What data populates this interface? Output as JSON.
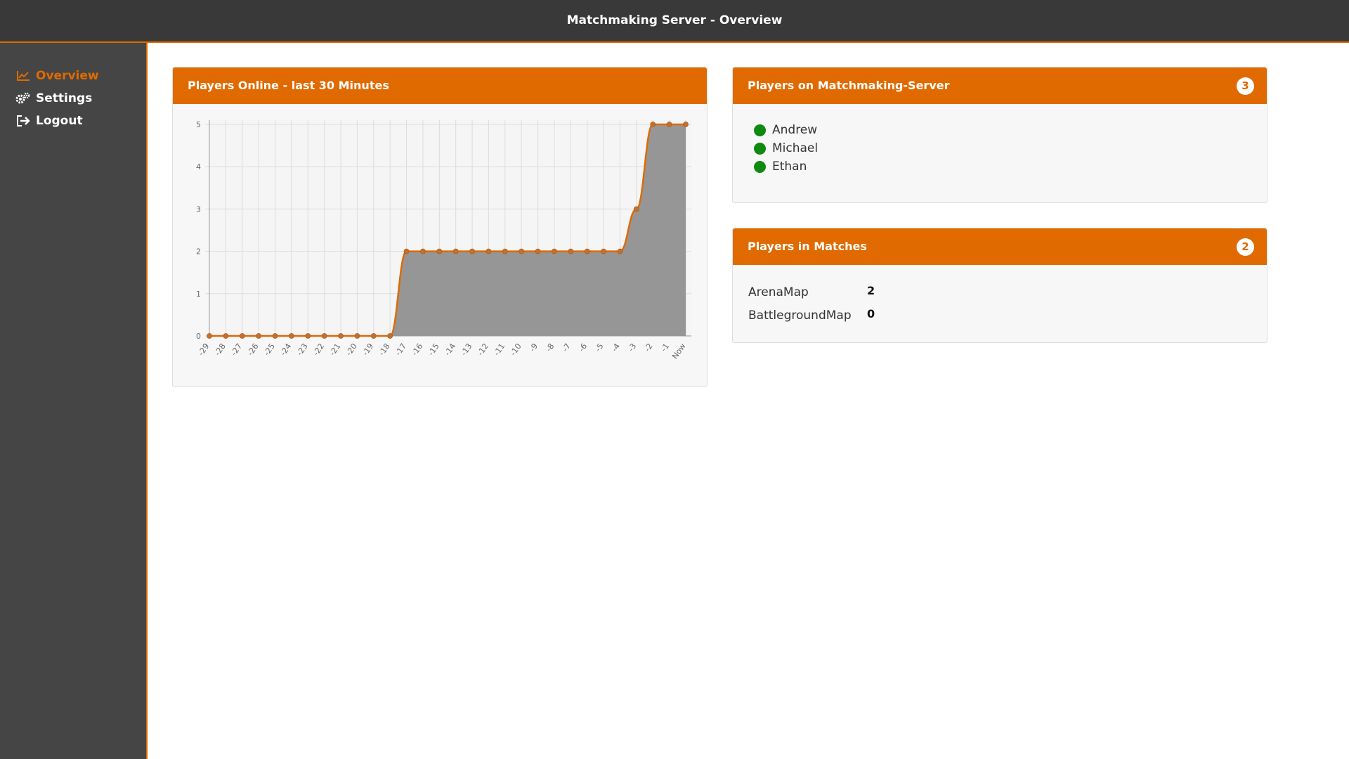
{
  "header": {
    "title": "Matchmaking Server - Overview"
  },
  "sidebar": {
    "items": [
      {
        "label": "Overview",
        "icon": "line-chart-icon",
        "active": true
      },
      {
        "label": "Settings",
        "icon": "gears-icon",
        "active": false
      },
      {
        "label": "Logout",
        "icon": "sign-out-icon",
        "active": false
      }
    ]
  },
  "colors": {
    "accent": "#e06a00",
    "online": "#0e8a0e",
    "area": "#969696"
  },
  "players_online_panel": {
    "title": "Players Online - last 30 Minutes"
  },
  "server_panel": {
    "title": "Players on Matchmaking-Server",
    "count": "3",
    "players": [
      "Andrew",
      "Michael",
      "Ethan"
    ]
  },
  "matches_panel": {
    "title": "Players in Matches",
    "count": "2",
    "maps": [
      {
        "name": "ArenaMap",
        "value": "2"
      },
      {
        "name": "BattlegroundMap",
        "value": "0"
      }
    ]
  },
  "chart_data": {
    "type": "area",
    "title": "",
    "xlabel": "",
    "ylabel": "",
    "ylim": [
      0,
      5
    ],
    "yticks": [
      "0",
      "1",
      "2",
      "3",
      "4",
      "5"
    ],
    "categories": [
      "-29",
      "-28",
      "-27",
      "-26",
      "-25",
      "-24",
      "-23",
      "-22",
      "-21",
      "-20",
      "-19",
      "-18",
      "-17",
      "-16",
      "-15",
      "-14",
      "-13",
      "-12",
      "-11",
      "-10",
      "-9",
      "-8",
      "-7",
      "-6",
      "-5",
      "-4",
      "-3",
      "-2",
      "-1",
      "Now"
    ],
    "values": [
      0,
      0,
      0,
      0,
      0,
      0,
      0,
      0,
      0,
      0,
      0,
      0,
      2,
      2,
      2,
      2,
      2,
      2,
      2,
      2,
      2,
      2,
      2,
      2,
      2,
      2,
      3,
      5,
      5,
      5
    ],
    "grid": true,
    "line_color": "#e06a00",
    "fill_color": "#969696"
  }
}
